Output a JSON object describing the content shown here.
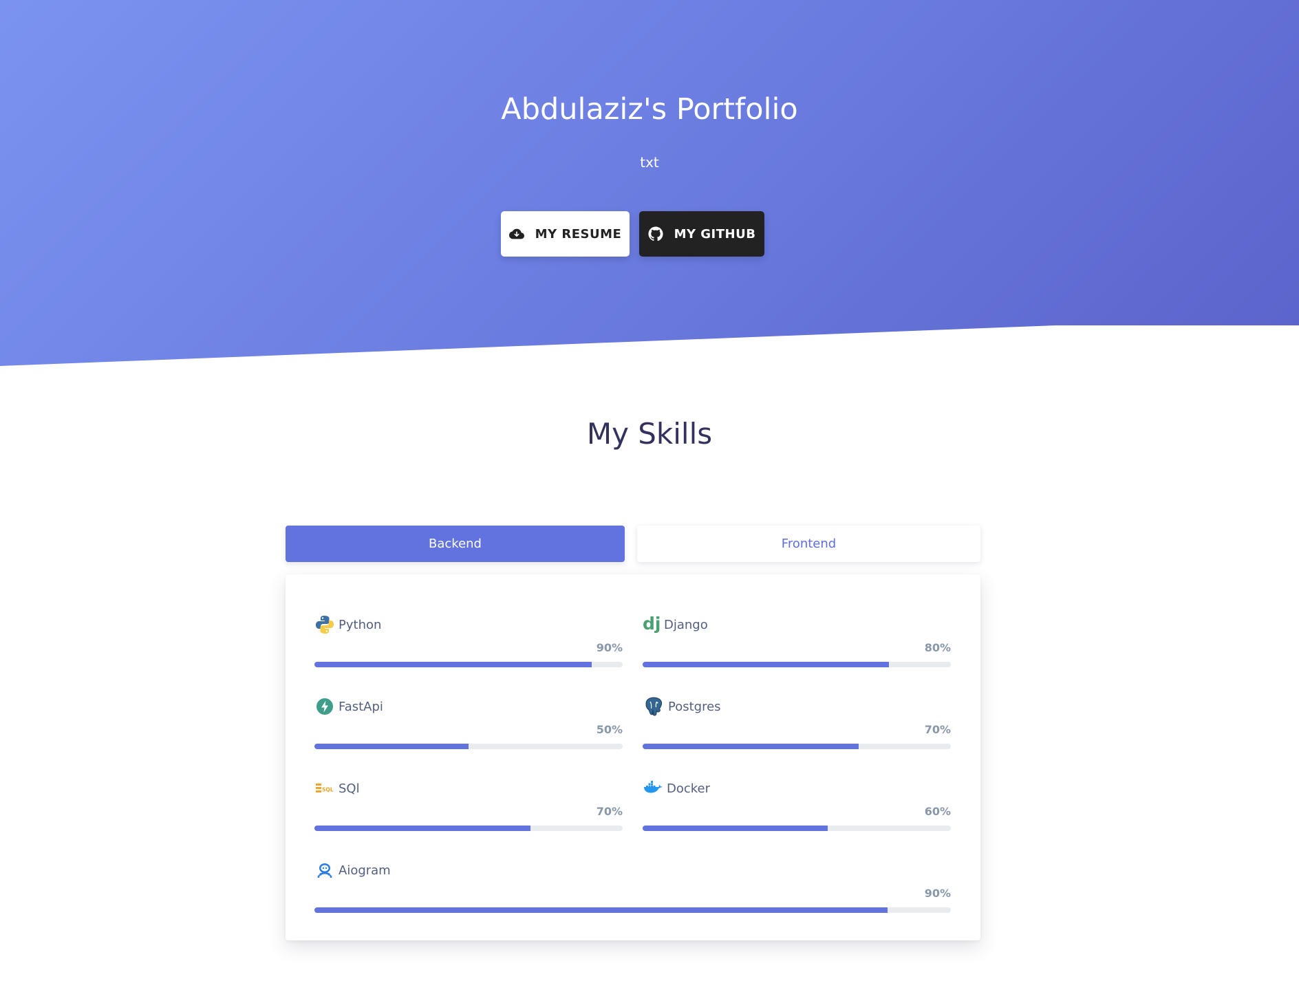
{
  "hero": {
    "title": "Abdulaziz's Portfolio",
    "subtitle": "txt",
    "resume_label": "MY RESUME",
    "github_label": "MY GITHUB"
  },
  "skills": {
    "title": "My Skills",
    "tabs": [
      {
        "label": "Backend",
        "active": true
      },
      {
        "label": "Frontend",
        "active": false
      }
    ],
    "items": [
      {
        "name": "Python",
        "percent_label": "90%",
        "value": 90,
        "icon": "python-icon"
      },
      {
        "name": "Django",
        "percent_label": "80%",
        "value": 80,
        "icon": "django-icon"
      },
      {
        "name": "FastApi",
        "percent_label": "50%",
        "value": 50,
        "icon": "fastapi-icon"
      },
      {
        "name": "Postgres",
        "percent_label": "70%",
        "value": 70,
        "icon": "postgres-icon"
      },
      {
        "name": "SQl",
        "percent_label": "70%",
        "value": 70,
        "icon": "sql-icon"
      },
      {
        "name": "Docker",
        "percent_label": "60%",
        "value": 60,
        "icon": "docker-icon"
      },
      {
        "name": "Aiogram",
        "percent_label": "90%",
        "value": 90,
        "icon": "aiogram-icon"
      }
    ]
  },
  "colors": {
    "accent": "#6272de",
    "hero_start": "#7b93f0",
    "hero_end": "#5a63cb",
    "dark_button": "#222222"
  }
}
